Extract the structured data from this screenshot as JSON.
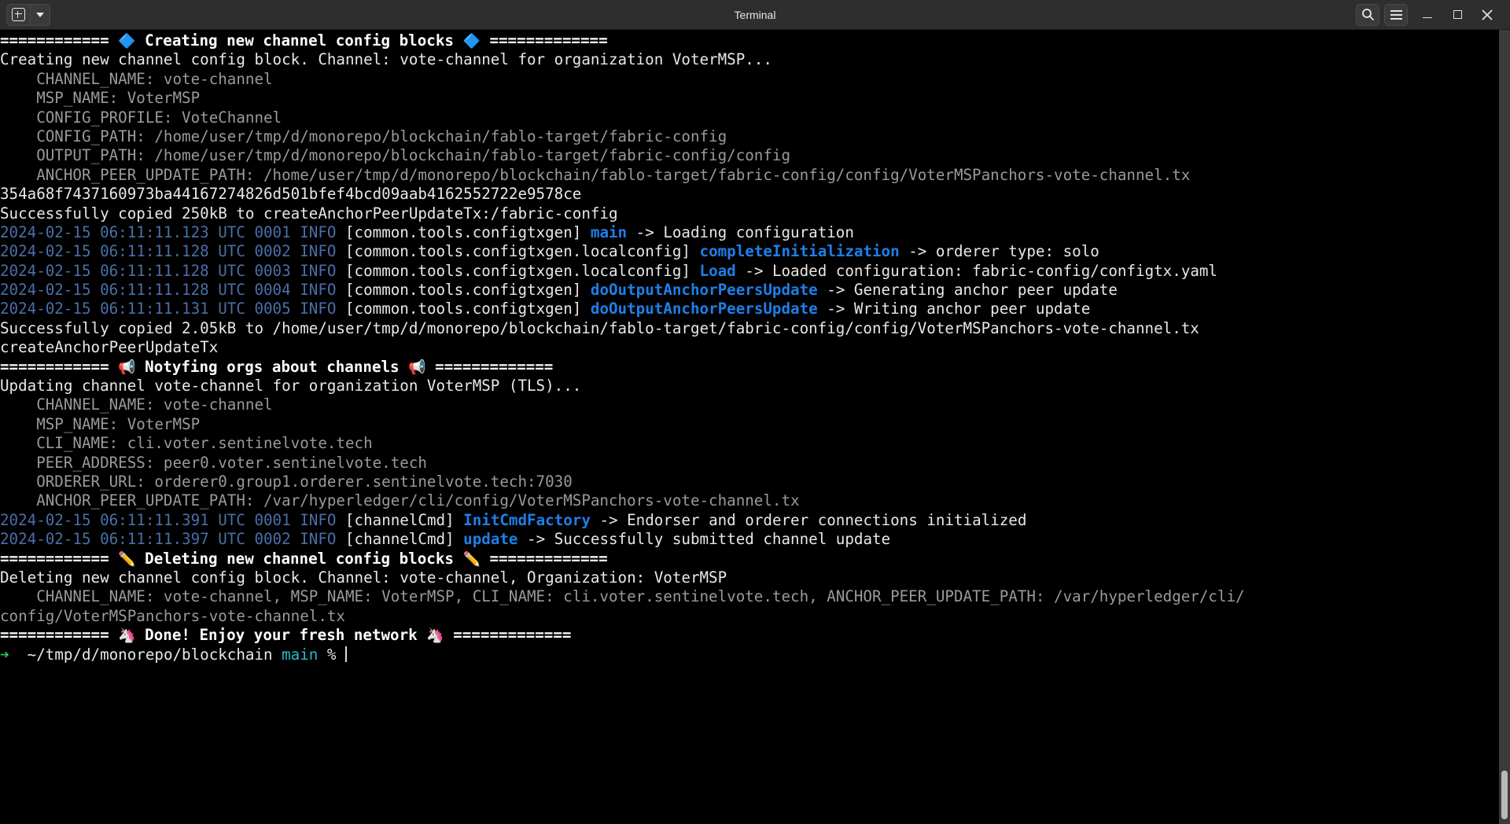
{
  "window": {
    "title": "Terminal",
    "new_tab_label": "+",
    "dropdown_label": "▾",
    "search_label": "search-icon",
    "menu_label": "menu-icon",
    "minimize_label": "minimize",
    "maximize_label": "maximize",
    "close_label": "✕"
  },
  "colors": {
    "background": "#000000",
    "titlebar": "#2e2e2e",
    "foreground": "#e8e8e8",
    "dim": "#9a9a9a",
    "timestamp_blue": "#4a6fa8",
    "function_blue": "#1e7fe8",
    "branch_cyan": "#2bb8c8",
    "prompt_green": "#25c45a"
  },
  "scrollbar": {
    "position": "bottom"
  },
  "terminal": {
    "lines": [
      {
        "id": "hdr-creating",
        "segments": [
          {
            "text": "============ ",
            "style": "wb"
          },
          {
            "text": "🔷",
            "style": "em"
          },
          {
            "text": " Creating new channel config blocks ",
            "style": "wb"
          },
          {
            "text": "🔷",
            "style": "em"
          },
          {
            "text": " =============",
            "style": "wb"
          }
        ]
      },
      {
        "id": "creating-block",
        "segments": [
          {
            "text": "Creating new channel config block. Channel: vote-channel for organization VoterMSP...",
            "style": "w"
          }
        ]
      },
      {
        "id": "k-channel-name-1",
        "segments": [
          {
            "text": "    CHANNEL_NAME: vote-channel",
            "style": "g"
          }
        ]
      },
      {
        "id": "k-msp-name-1",
        "segments": [
          {
            "text": "    MSP_NAME: VoterMSP",
            "style": "g"
          }
        ]
      },
      {
        "id": "k-config-profile",
        "segments": [
          {
            "text": "    CONFIG_PROFILE: VoteChannel",
            "style": "g"
          }
        ]
      },
      {
        "id": "k-config-path",
        "segments": [
          {
            "text": "    CONFIG_PATH: /home/user/tmp/d/monorepo/blockchain/fablo-target/fabric-config",
            "style": "g"
          }
        ]
      },
      {
        "id": "k-output-path",
        "segments": [
          {
            "text": "    OUTPUT_PATH: /home/user/tmp/d/monorepo/blockchain/fablo-target/fabric-config/config",
            "style": "g"
          }
        ]
      },
      {
        "id": "k-anchor-path-1",
        "segments": [
          {
            "text": "    ANCHOR_PEER_UPDATE_PATH: /home/user/tmp/d/monorepo/blockchain/fablo-target/fabric-config/config/VoterMSPanchors-vote-channel.tx",
            "style": "g"
          }
        ]
      },
      {
        "id": "hash",
        "segments": [
          {
            "text": "354a68f7437160973ba44167274826d501bfef4bcd09aab4162552722e9578ce",
            "style": "w"
          }
        ]
      },
      {
        "id": "copied-250kb",
        "segments": [
          {
            "text": "Successfully copied 250kB to createAnchorPeerUpdateTx:/fabric-config",
            "style": "w"
          }
        ]
      },
      {
        "id": "log-0001-configtxgen",
        "segments": [
          {
            "text": "2024-02-15 06:11:11.123 UTC 0001 INFO ",
            "style": "ts"
          },
          {
            "text": "[common.tools.configtxgen] ",
            "style": "w"
          },
          {
            "text": "main",
            "style": "fn"
          },
          {
            "text": " -> Loading configuration",
            "style": "w"
          }
        ]
      },
      {
        "id": "log-0002-localconfig",
        "segments": [
          {
            "text": "2024-02-15 06:11:11.128 UTC 0002 INFO ",
            "style": "ts"
          },
          {
            "text": "[common.tools.configtxgen.localconfig] ",
            "style": "w"
          },
          {
            "text": "completeInitialization",
            "style": "fn"
          },
          {
            "text": " -> orderer type: solo",
            "style": "w"
          }
        ]
      },
      {
        "id": "log-0003-load",
        "segments": [
          {
            "text": "2024-02-15 06:11:11.128 UTC 0003 INFO ",
            "style": "ts"
          },
          {
            "text": "[common.tools.configtxgen.localconfig] ",
            "style": "w"
          },
          {
            "text": "Load",
            "style": "fn"
          },
          {
            "text": " -> Loaded configuration: fabric-config/configtx.yaml",
            "style": "w"
          }
        ]
      },
      {
        "id": "log-0004-anchorpeers",
        "segments": [
          {
            "text": "2024-02-15 06:11:11.128 UTC 0004 INFO ",
            "style": "ts"
          },
          {
            "text": "[common.tools.configtxgen] ",
            "style": "w"
          },
          {
            "text": "doOutputAnchorPeersUpdate",
            "style": "fn"
          },
          {
            "text": " -> Generating anchor peer update",
            "style": "w"
          }
        ]
      },
      {
        "id": "log-0005-anchorpeers",
        "segments": [
          {
            "text": "2024-02-15 06:11:11.131 UTC 0005 INFO ",
            "style": "ts"
          },
          {
            "text": "[common.tools.configtxgen] ",
            "style": "w"
          },
          {
            "text": "doOutputAnchorPeersUpdate",
            "style": "fn"
          },
          {
            "text": " -> Writing anchor peer update",
            "style": "w"
          }
        ]
      },
      {
        "id": "copied-205kb",
        "segments": [
          {
            "text": "Successfully copied 2.05kB to /home/user/tmp/d/monorepo/blockchain/fablo-target/fabric-config/config/VoterMSPanchors-vote-channel.tx",
            "style": "w"
          }
        ]
      },
      {
        "id": "create-anchor-tx",
        "segments": [
          {
            "text": "createAnchorPeerUpdateTx",
            "style": "w"
          }
        ]
      },
      {
        "id": "hdr-notifying",
        "segments": [
          {
            "text": "============ ",
            "style": "wb"
          },
          {
            "text": "📢",
            "style": "em"
          },
          {
            "text": " Notyfing orgs about channels ",
            "style": "wb"
          },
          {
            "text": "📢",
            "style": "em"
          },
          {
            "text": " =============",
            "style": "wb"
          }
        ]
      },
      {
        "id": "updating-channel",
        "segments": [
          {
            "text": "Updating channel vote-channel for organization VoterMSP (TLS)...",
            "style": "w"
          }
        ]
      },
      {
        "id": "k-channel-name-2",
        "segments": [
          {
            "text": "    CHANNEL_NAME: vote-channel",
            "style": "g"
          }
        ]
      },
      {
        "id": "k-msp-name-2",
        "segments": [
          {
            "text": "    MSP_NAME: VoterMSP",
            "style": "g"
          }
        ]
      },
      {
        "id": "k-cli-name",
        "segments": [
          {
            "text": "    CLI_NAME: cli.voter.sentinelvote.tech",
            "style": "g"
          }
        ]
      },
      {
        "id": "k-peer-address",
        "segments": [
          {
            "text": "    PEER_ADDRESS: peer0.voter.sentinelvote.tech",
            "style": "g"
          }
        ]
      },
      {
        "id": "k-orderer-url",
        "segments": [
          {
            "text": "    ORDERER_URL: orderer0.group1.orderer.sentinelvote.tech:7030",
            "style": "g"
          }
        ]
      },
      {
        "id": "k-anchor-path-2",
        "segments": [
          {
            "text": "    ANCHOR_PEER_UPDATE_PATH: /var/hyperledger/cli/config/VoterMSPanchors-vote-channel.tx",
            "style": "g"
          }
        ]
      },
      {
        "id": "log-0001-channelcmd",
        "segments": [
          {
            "text": "2024-02-15 06:11:11.391 UTC 0001 INFO ",
            "style": "ts"
          },
          {
            "text": "[channelCmd] ",
            "style": "w"
          },
          {
            "text": "InitCmdFactory",
            "style": "fn"
          },
          {
            "text": " -> Endorser and orderer connections initialized",
            "style": "w"
          }
        ]
      },
      {
        "id": "log-0002-channelcmd",
        "segments": [
          {
            "text": "2024-02-15 06:11:11.397 UTC 0002 INFO ",
            "style": "ts"
          },
          {
            "text": "[channelCmd] ",
            "style": "w"
          },
          {
            "text": "update",
            "style": "fn"
          },
          {
            "text": " -> Successfully submitted channel update",
            "style": "w"
          }
        ]
      },
      {
        "id": "hdr-deleting",
        "segments": [
          {
            "text": "============ ",
            "style": "wb"
          },
          {
            "text": "✏️",
            "style": "em"
          },
          {
            "text": " Deleting new channel config blocks ",
            "style": "wb"
          },
          {
            "text": "✏️",
            "style": "em"
          },
          {
            "text": " =============",
            "style": "wb"
          }
        ]
      },
      {
        "id": "deleting-block",
        "segments": [
          {
            "text": "Deleting new channel config block. Channel: vote-channel, Organization: VoterMSP",
            "style": "w"
          }
        ]
      },
      {
        "id": "k-combined-1",
        "segments": [
          {
            "text": "    CHANNEL_NAME: vote-channel, MSP_NAME: VoterMSP, CLI_NAME: cli.voter.sentinelvote.tech, ANCHOR_PEER_UPDATE_PATH: /var/hyperledger/cli/",
            "style": "g"
          }
        ]
      },
      {
        "id": "k-combined-2",
        "segments": [
          {
            "text": "config/VoterMSPanchors-vote-channel.tx",
            "style": "g"
          }
        ]
      },
      {
        "id": "hdr-done",
        "segments": [
          {
            "text": "============ ",
            "style": "wb"
          },
          {
            "text": "🦄",
            "style": "em"
          },
          {
            "text": " Done! Enjoy your fresh network ",
            "style": "wb"
          },
          {
            "text": "🦄",
            "style": "em"
          },
          {
            "text": " =============",
            "style": "wb"
          }
        ]
      },
      {
        "id": "prompt",
        "segments": [
          {
            "text": "➜",
            "style": "grn"
          },
          {
            "text": "  ~/tmp/d/monorepo/blockchain ",
            "style": "w"
          },
          {
            "text": "main",
            "style": "cy"
          },
          {
            "text": " % ",
            "style": "w"
          },
          {
            "text": "",
            "style": "cursor"
          }
        ]
      }
    ]
  }
}
